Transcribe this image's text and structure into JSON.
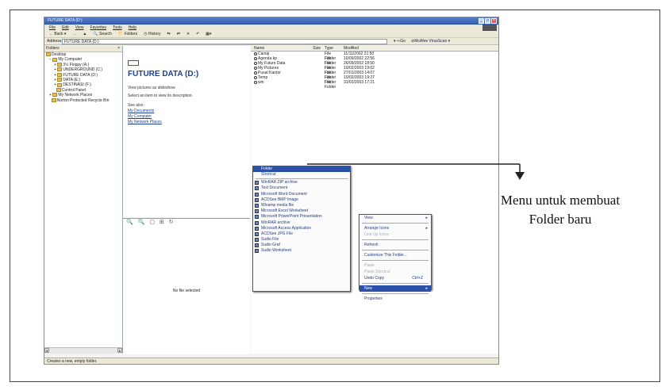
{
  "window": {
    "title": "FUTURE DATA (D:)"
  },
  "menubar": [
    "File",
    "Edit",
    "View",
    "Favorites",
    "Tools",
    "Help"
  ],
  "toolbar": {
    "back": "Back",
    "search": "Search",
    "folders": "Folders",
    "history": "History"
  },
  "address": {
    "label": "Address",
    "value": "FUTURE DATA (D:)",
    "go": "Go",
    "extension": "McAfee VirusScan"
  },
  "folders": {
    "header": "Folders",
    "close": "×",
    "items": [
      {
        "label": "Desktop",
        "level": 1
      },
      {
        "label": "My Computer",
        "level": 2
      },
      {
        "label": "3½ Floppy (A:)",
        "level": 3
      },
      {
        "label": "UNDERGROUND (C:)",
        "level": 3
      },
      {
        "label": "FUTURE DATA (D:)",
        "level": 3
      },
      {
        "label": "DATA (E:)",
        "level": 3
      },
      {
        "label": "DESTINASI (F:)",
        "level": 3
      },
      {
        "label": "Control Panel",
        "level": 3
      },
      {
        "label": "My Network Places",
        "level": 2
      },
      {
        "label": "Norton Protected Recycle Bin",
        "level": 2
      }
    ]
  },
  "info": {
    "title": "FUTURE DATA (D:)",
    "view_pictures": "View pictures as slideshow",
    "select_item": "Select an item to view its description.",
    "see_also": "See also:",
    "links": [
      "My Documents",
      "My Computer",
      "My Network Places"
    ]
  },
  "preview": {
    "tools": "🔍 🔍 ▢ ⊞ ↻",
    "no_file": "No file selected"
  },
  "filelist": {
    "columns": [
      "Name",
      "Size",
      "Type",
      "Modified"
    ],
    "rows": [
      {
        "name": "Carsip",
        "size": "",
        "type": "File Folder",
        "modified": "11/11/2002 21:50"
      },
      {
        "name": "Agenda kp",
        "size": "",
        "type": "File Folder",
        "modified": "10/09/2002 22:56"
      },
      {
        "name": "My Future Data",
        "size": "",
        "type": "File Folder",
        "modified": "26/09/2002 18:50"
      },
      {
        "name": "My Pictures",
        "size": "",
        "type": "File Folder",
        "modified": "10/02/2003 19:02"
      },
      {
        "name": "Pusat Kantor",
        "size": "",
        "type": "File Folder",
        "modified": "27/01/2003 14:07"
      },
      {
        "name": "Temp",
        "size": "",
        "type": "File Folder",
        "modified": "10/02/2003 19:27"
      },
      {
        "name": "win",
        "size": "",
        "type": "File Folder",
        "modified": "31/01/2003 17:21"
      }
    ]
  },
  "new_menu": {
    "folder": "Folder",
    "shortcut": "Shortcut",
    "items": [
      "WinRAR ZIP archive",
      "Text Document",
      "Microsoft Word Document",
      "ACDSee BMP Image",
      "Winamp media file",
      "Microsoft Excel Worksheet",
      "Microsoft PowerPoint Presentation",
      "WinRAR archive",
      "Microsoft Access Application",
      "ACDSee JPG File",
      "Sudio File",
      "Sudio Graf",
      "Sudio Worksheet"
    ]
  },
  "context_menu": {
    "view": "View",
    "arrange": "Arrange Icons",
    "line_up": "Line Up Icons",
    "refresh": "Refresh",
    "customize": "Customize This Folder...",
    "paste": "Paste",
    "paste_shortcut": "Paste Shortcut",
    "undo": "Undo Copy",
    "undo_shortcut": "Ctrl+Z",
    "new": "New",
    "properties": "Properties"
  },
  "status": {
    "text": "Creates a new, empty folder."
  },
  "caption": {
    "line1": "Menu untuk membuat",
    "line2": "Folder baru"
  }
}
